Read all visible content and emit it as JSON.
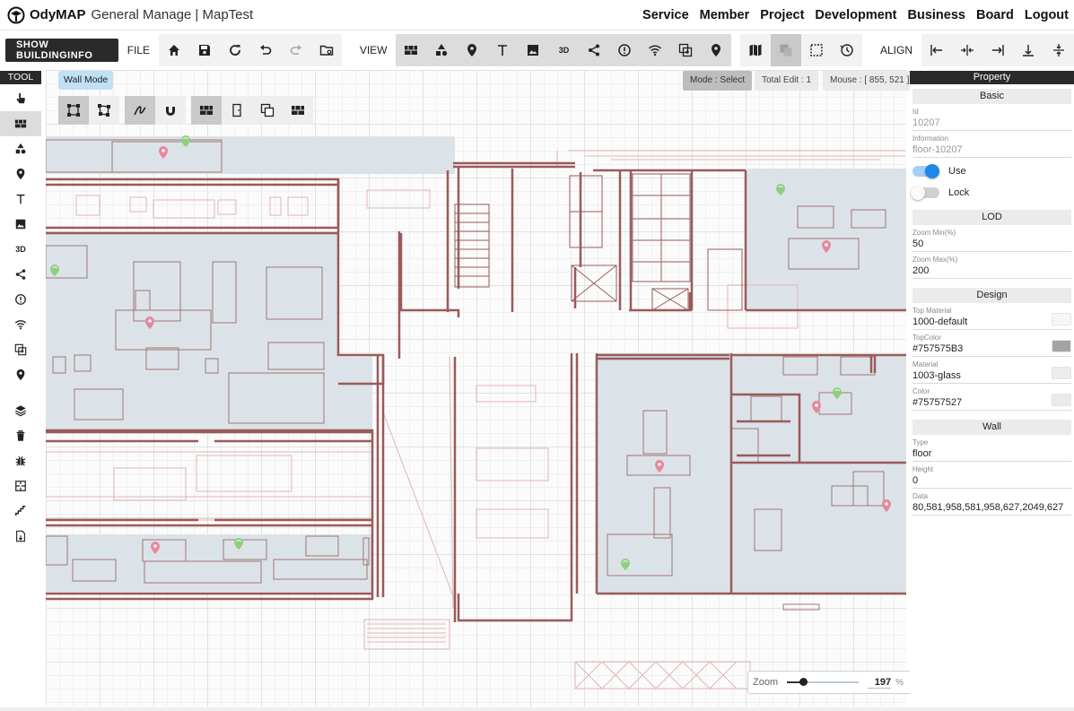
{
  "app": {
    "brand": "OdyMAP",
    "subtitle": "General Manage | MapTest"
  },
  "topnav": [
    "Service",
    "Member",
    "Project",
    "Development",
    "Business",
    "Board",
    "Logout"
  ],
  "toolbar": {
    "show_building_label": "SHOW BUILDINGINFO",
    "file_label": "FILE",
    "view_label": "VIEW",
    "align_label": "ALIGN",
    "view_3d_label": "3D"
  },
  "tool": {
    "title": "TOOL",
    "label_3d": "3D"
  },
  "canvas": {
    "wall_mode": "Wall Mode",
    "status_mode": "Mode : Select",
    "status_total": "Total Edit : 1",
    "status_mouse": "Mouse : [ 855, 521 ]"
  },
  "zoom": {
    "label": "Zoom",
    "value": "197",
    "unit": "%",
    "slider_fraction": 0.22
  },
  "property": {
    "title": "Property",
    "basic": {
      "title": "Basic",
      "id_label": "Id",
      "id_value": "10207",
      "info_label": "Information",
      "info_value": "floor-10207",
      "use_label": "Use",
      "use_on": true,
      "lock_label": "Lock",
      "lock_on": false
    },
    "lod": {
      "title": "LOD",
      "zoom_min_label": "Zoom Min(%)",
      "zoom_min_value": "50",
      "zoom_max_label": "Zoom Max(%)",
      "zoom_max_value": "200"
    },
    "design": {
      "title": "Design",
      "top_material_label": "Top Material",
      "top_material_value": "1000-default",
      "top_color_label": "TopColor",
      "top_color_value": "#757575B3",
      "material_label": "Material",
      "material_value": "1003-glass",
      "color_label": "Color",
      "color_value": "#75757527"
    },
    "wall": {
      "title": "Wall",
      "type_label": "Type",
      "type_value": "floor",
      "height_label": "Height",
      "height_value": "0",
      "data_label": "Data",
      "data_value": "80,581,958,581,958,627,2049,627"
    }
  },
  "colors": {
    "toggle_on": "#1e88e5",
    "swatch_top": "#a3a3a3",
    "swatch_default": "#f6f6f6",
    "swatch_glass": "#ececec",
    "swatch_color": "#eaeaea",
    "room_fill": "#dbe3e8",
    "wall_stroke": "#9b5a5a",
    "pin": "#e8879b",
    "wifi_pin": "#8fcf7f"
  }
}
